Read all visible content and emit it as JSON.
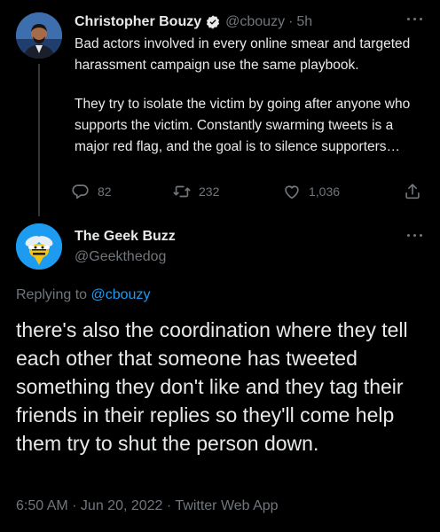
{
  "parent_tweet": {
    "author_name": "Christopher Bouzy",
    "author_handle": "@cbouzy",
    "separator": "·",
    "time_ago": "5h",
    "paragraph1": "Bad actors involved in every online smear and targeted harassment campaign use the same playbook.",
    "paragraph2": "They try to isolate the victim by going after anyone who supports the victim. Constantly swarming tweets is a major red flag, and the goal is to silence supporters…",
    "replies_count": "82",
    "retweets_count": "232",
    "likes_count": "1,036",
    "icons": [
      "verified-badge-icon",
      "more-icon",
      "reply-icon",
      "retweet-icon",
      "like-icon",
      "share-icon"
    ]
  },
  "reply_tweet": {
    "author_name": "The Geek Buzz",
    "author_handle": "@Geekthedog",
    "replying_label": "Replying to",
    "replying_mention": "@cbouzy",
    "text": "there's also the coordination where they tell each other that someone has tweeted something they don't like and they tag their friends in their replies so they'll come help them try to shut the person down.",
    "timestamp": "6:50 AM · Jun 20, 2022 · Twitter Web App",
    "icons": [
      "more-icon"
    ]
  },
  "colors": {
    "background": "#000000",
    "text_primary": "#e7e9ea",
    "text_secondary": "#71767b",
    "accent": "#1d9bf0",
    "thread_line": "#333639"
  }
}
